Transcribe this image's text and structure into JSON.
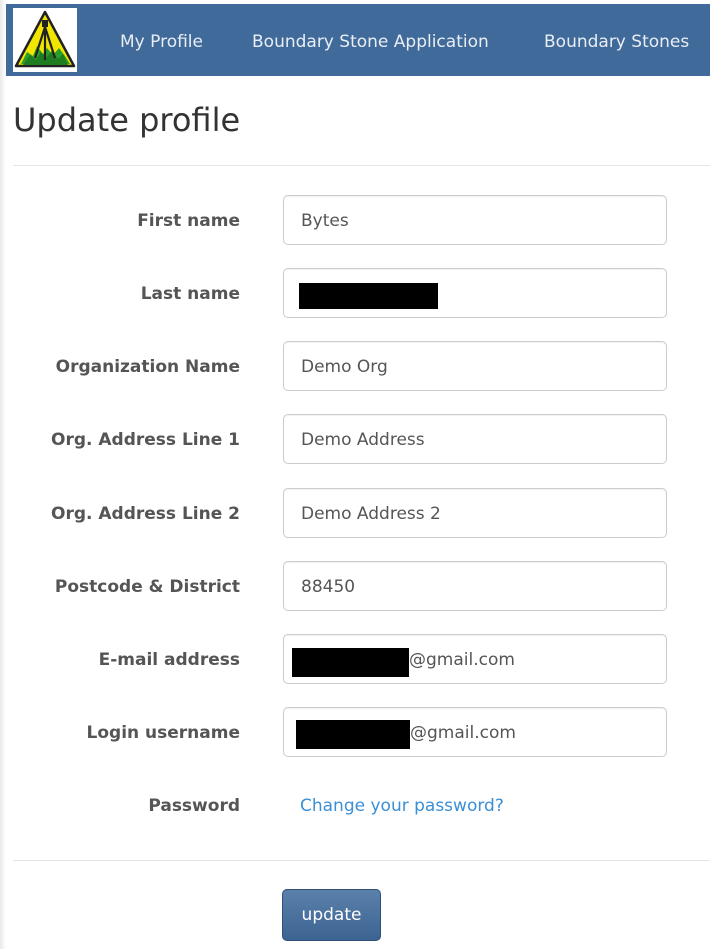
{
  "navbar": {
    "logo_icon": "surveyor-tripod-logo-icon",
    "links": [
      "My Profile",
      "Boundary Stone Application",
      "Boundary Stones"
    ]
  },
  "page_title": "Update profile",
  "form": {
    "first_name": {
      "label": "First name",
      "value": "Bytes"
    },
    "last_name": {
      "label": "Last name",
      "value": ""
    },
    "organization_name": {
      "label": "Organization Name",
      "value": "Demo Org"
    },
    "org_address_line_1": {
      "label": "Org. Address Line 1",
      "value": "Demo Address"
    },
    "org_address_line_2": {
      "label": "Org. Address Line 2",
      "value": "Demo Address 2"
    },
    "postcode_district": {
      "label": "Postcode & District",
      "value": "88450"
    },
    "email": {
      "label": "E-mail address",
      "value_suffix": "@gmail.com"
    },
    "login_username": {
      "label": "Login username",
      "value_suffix": "@gmail.com"
    },
    "password": {
      "label": "Password",
      "link_text": "Change your password?"
    }
  },
  "update_button_label": "update",
  "colors": {
    "navbar_bg": "#406a99",
    "link": "#3a8fd6",
    "button_bg": "#4a70a0"
  }
}
